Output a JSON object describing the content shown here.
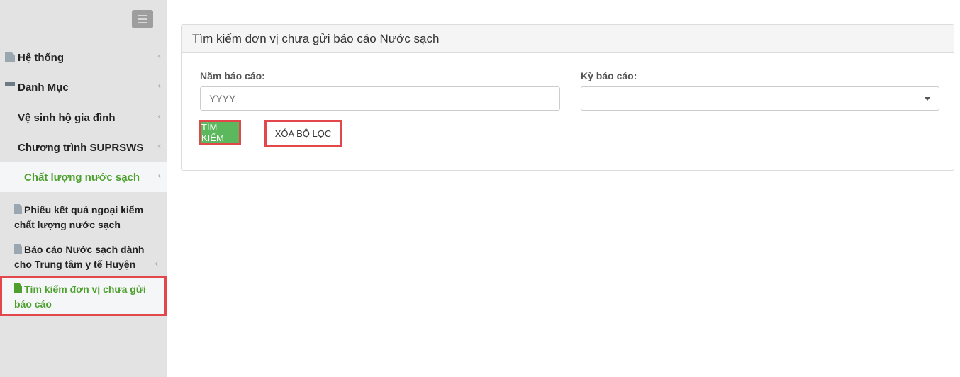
{
  "sidebar": {
    "items": [
      {
        "label": "Hệ thống",
        "icon": "file-icon"
      },
      {
        "label": "Danh Mục",
        "icon": "list-icon"
      },
      {
        "label": "Vệ sinh hộ gia đình",
        "icon": "server-icon"
      },
      {
        "label": "Chương trình SUPRSWS",
        "icon": "server-icon"
      },
      {
        "label": "Chất lượng nước sạch",
        "icon": "server-icon"
      }
    ],
    "subitems": [
      {
        "label": "Phiếu kết quả ngoại kiểm chất lượng nước sạch"
      },
      {
        "label": "Báo cáo Nước sạch dành cho Trung tâm y tế Huyện"
      },
      {
        "label": "Tìm kiếm đơn vị chưa gửi báo cáo"
      }
    ],
    "chevron": "‹"
  },
  "panel": {
    "title": "Tìm kiếm đơn vị chưa gửi báo cáo Nước sạch",
    "year_label": "Năm báo cáo:",
    "year_placeholder": "YYYY",
    "period_label": "Kỳ báo cáo:",
    "period_value": "",
    "search_button": "TÌM KIẾM",
    "clear_button": "XÓA BỘ LỌC"
  },
  "colors": {
    "accent_green": "#4ea02e",
    "button_green": "#5cb85c",
    "highlight_red": "#e2474b"
  }
}
